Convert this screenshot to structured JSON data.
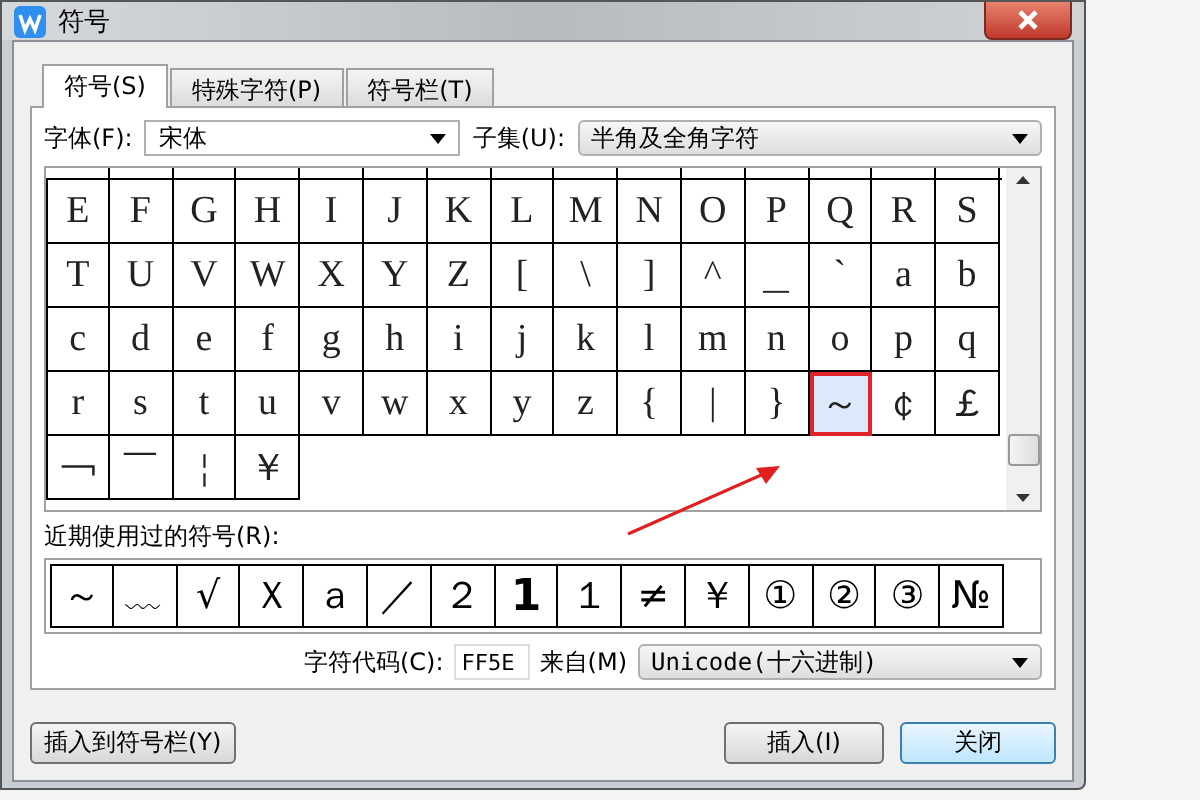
{
  "window": {
    "title": "符号"
  },
  "tabs": [
    {
      "label": "符号(S)",
      "selected": true
    },
    {
      "label": "特殊字符(P)",
      "selected": false
    },
    {
      "label": "符号栏(T)",
      "selected": false
    }
  ],
  "font": {
    "label": "字体(F):",
    "value": "宋体"
  },
  "subset": {
    "label": "子集(U):",
    "value": "半角及全角字符"
  },
  "symbol_grid": {
    "rows": [
      [
        {
          "char": "E",
          "selected": false
        },
        {
          "char": "F",
          "selected": false
        },
        {
          "char": "G",
          "selected": false
        },
        {
          "char": "H",
          "selected": false
        },
        {
          "char": "I",
          "selected": false
        },
        {
          "char": "J",
          "selected": false
        },
        {
          "char": "K",
          "selected": false
        },
        {
          "char": "L",
          "selected": false
        },
        {
          "char": "M",
          "selected": false
        },
        {
          "char": "N",
          "selected": false
        },
        {
          "char": "O",
          "selected": false
        },
        {
          "char": "P",
          "selected": false
        },
        {
          "char": "Q",
          "selected": false
        },
        {
          "char": "R",
          "selected": false
        },
        {
          "char": "S",
          "selected": false
        }
      ],
      [
        {
          "char": "T",
          "selected": false
        },
        {
          "char": "U",
          "selected": false
        },
        {
          "char": "V",
          "selected": false
        },
        {
          "char": "W",
          "selected": false
        },
        {
          "char": "X",
          "selected": false
        },
        {
          "char": "Y",
          "selected": false
        },
        {
          "char": "Z",
          "selected": false
        },
        {
          "char": "[",
          "selected": false
        },
        {
          "char": "\\",
          "selected": false
        },
        {
          "char": "]",
          "selected": false
        },
        {
          "char": "^",
          "selected": false
        },
        {
          "char": "＿",
          "selected": false
        },
        {
          "char": "`",
          "selected": false
        },
        {
          "char": "a",
          "selected": false
        },
        {
          "char": "b",
          "selected": false
        }
      ],
      [
        {
          "char": "c",
          "selected": false
        },
        {
          "char": "d",
          "selected": false
        },
        {
          "char": "e",
          "selected": false
        },
        {
          "char": "f",
          "selected": false
        },
        {
          "char": "g",
          "selected": false
        },
        {
          "char": "h",
          "selected": false
        },
        {
          "char": "i",
          "selected": false
        },
        {
          "char": "j",
          "selected": false
        },
        {
          "char": "k",
          "selected": false
        },
        {
          "char": "l",
          "selected": false
        },
        {
          "char": "m",
          "selected": false
        },
        {
          "char": "n",
          "selected": false
        },
        {
          "char": "o",
          "selected": false
        },
        {
          "char": "p",
          "selected": false
        },
        {
          "char": "q",
          "selected": false
        }
      ],
      [
        {
          "char": "r",
          "selected": false
        },
        {
          "char": "s",
          "selected": false
        },
        {
          "char": "t",
          "selected": false
        },
        {
          "char": "u",
          "selected": false
        },
        {
          "char": "v",
          "selected": false
        },
        {
          "char": "w",
          "selected": false
        },
        {
          "char": "x",
          "selected": false
        },
        {
          "char": "y",
          "selected": false
        },
        {
          "char": "z",
          "selected": false
        },
        {
          "char": "{",
          "selected": false
        },
        {
          "char": "|",
          "selected": false
        },
        {
          "char": "}",
          "selected": false
        },
        {
          "char": "～",
          "selected": true
        },
        {
          "char": "￠",
          "selected": false
        },
        {
          "char": "￡",
          "selected": false
        }
      ],
      [
        {
          "char": "￢",
          "selected": false
        },
        {
          "char": "￣",
          "selected": false
        },
        {
          "char": "￤",
          "selected": false
        },
        {
          "char": "￥",
          "selected": false
        }
      ]
    ]
  },
  "recent": {
    "label": "近期使用过的符号(R):",
    "symbols": [
      "～",
      "﹏",
      "√",
      "Ｘ",
      "ａ",
      "／",
      "２",
      "1",
      "１",
      "≠",
      "￥",
      "①",
      "②",
      "③",
      "№"
    ]
  },
  "char_code": {
    "label": "字符代码(C):",
    "value": "FF5E"
  },
  "from": {
    "label": "来自(M)",
    "value": "Unicode(十六进制)"
  },
  "buttons": [
    {
      "label": "插入到符号栏(Y)",
      "kind": "secondary"
    },
    {
      "label": "插入(I)",
      "kind": "normal"
    },
    {
      "label": "关闭",
      "kind": "default"
    }
  ]
}
